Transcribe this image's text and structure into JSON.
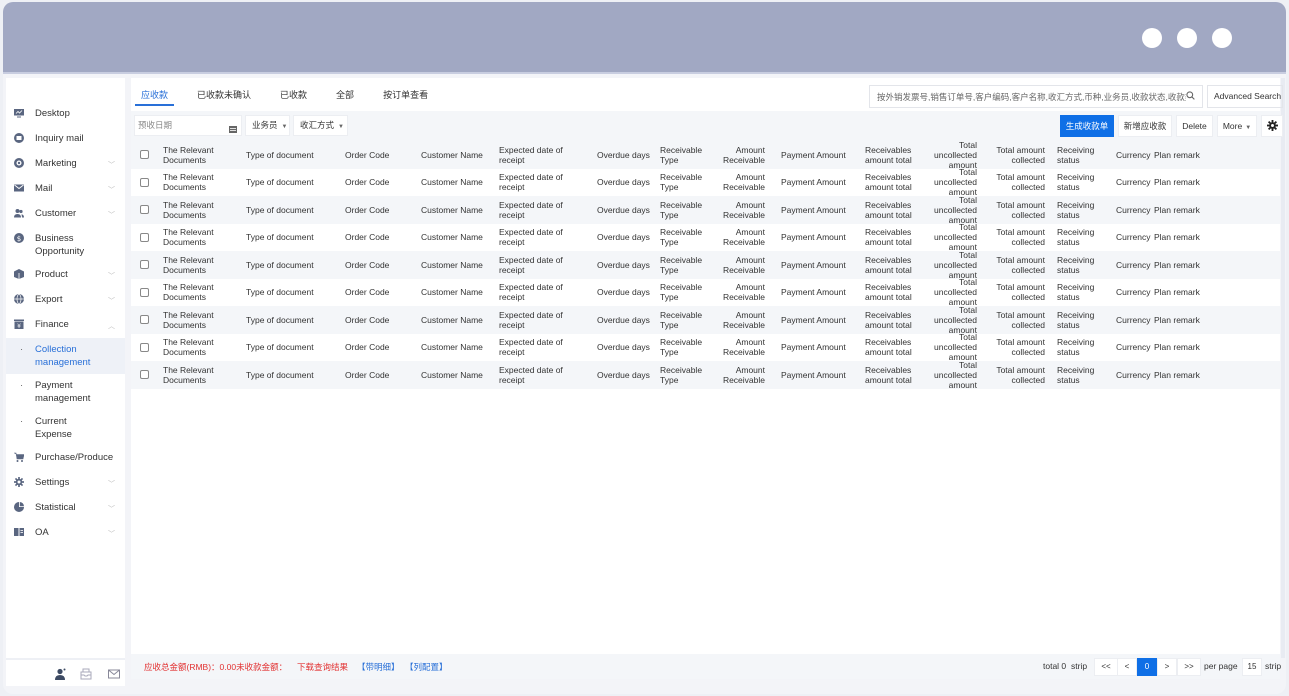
{
  "window": {
    "controls": [
      "dot",
      "dot",
      "dot"
    ]
  },
  "sidebar": {
    "items": [
      {
        "label": "Desktop",
        "icon": "desktop-icon",
        "chevron": false
      },
      {
        "label": "Inquiry mail",
        "icon": "inquiry-icon",
        "chevron": false
      },
      {
        "label": "Marketing",
        "icon": "marketing-icon",
        "chevron": true
      },
      {
        "label": "Mail",
        "icon": "mail-icon",
        "chevron": true
      },
      {
        "label": "Customer",
        "icon": "customer-icon",
        "chevron": true
      },
      {
        "label": "Business Opportunity",
        "icon": "dollar-icon",
        "chevron": false
      },
      {
        "label": "Product",
        "icon": "product-icon",
        "chevron": true
      },
      {
        "label": "Export",
        "icon": "globe-icon",
        "chevron": true
      },
      {
        "label": "Finance",
        "icon": "finance-icon",
        "chevron": "up"
      }
    ],
    "finance_sub": [
      {
        "label": "Collection management",
        "active": true
      },
      {
        "label": "Payment management",
        "active": false
      },
      {
        "label": "Current Expense",
        "active": false
      }
    ],
    "items_after": [
      {
        "label": "Purchase/Produce",
        "icon": "cart-icon",
        "chevron": false
      },
      {
        "label": "Settings",
        "icon": "gear-icon",
        "chevron": true
      },
      {
        "label": "Statistical",
        "icon": "pie-chart-icon",
        "chevron": true
      },
      {
        "label": "OA",
        "icon": "oa-icon",
        "chevron": true
      }
    ],
    "bottom_icons": [
      "user-icon",
      "inbox-icon",
      "envelope-icon"
    ]
  },
  "tabs": [
    {
      "label": "应收款",
      "active": true
    },
    {
      "label": "已收款未确认",
      "active": false
    },
    {
      "label": "已收款",
      "active": false
    },
    {
      "label": "全部",
      "active": false
    },
    {
      "label": "按订单查看",
      "active": false
    }
  ],
  "search": {
    "placeholder": "按外销发票号,销售订单号,客户编码,客户名称,收汇方式,币种,业务员,收款状态,收款类型",
    "advanced_label": "Advanced Search"
  },
  "filters": {
    "date_placeholder": "预收日期",
    "salesman_label": "业务员",
    "method_label": "收汇方式"
  },
  "actions": {
    "generate_label": "生成收款单",
    "add_label": "新增应收款",
    "delete_label": "Delete",
    "more_label": "More"
  },
  "table": {
    "columns": [
      "The Relevant Documents",
      "Type of document",
      "Order Code",
      "Customer Name",
      "Expected date of receipt",
      "Overdue days",
      "Receivable Type",
      "Amount Receivable",
      "Payment Amount",
      "Receivables amount total",
      "Total uncollected amount",
      "Total amount collected",
      "Receiving status",
      "Currency",
      "Plan remark"
    ],
    "rows": [
      [
        "The Relevant Documents",
        "Type of document",
        "Order Code",
        "Customer Name",
        "Expected date of receipt",
        "Overdue days",
        "Receivable Type",
        "Amount Receivable",
        "Payment Amount",
        "Receivables amount total",
        "Total uncollected amount",
        "Total amount collected",
        "Receiving status",
        "Currency",
        "Plan remark"
      ],
      [
        "The Relevant Documents",
        "Type of document",
        "Order Code",
        "Customer Name",
        "Expected date of receipt",
        "Overdue days",
        "Receivable Type",
        "Amount Receivable",
        "Payment Amount",
        "Receivables amount total",
        "Total uncollected amount",
        "Total amount collected",
        "Receiving status",
        "Currency",
        "Plan remark"
      ],
      [
        "The Relevant Documents",
        "Type of document",
        "Order Code",
        "Customer Name",
        "Expected date of receipt",
        "Overdue days",
        "Receivable Type",
        "Amount Receivable",
        "Payment Amount",
        "Receivables amount total",
        "Total uncollected amount",
        "Total amount collected",
        "Receiving status",
        "Currency",
        "Plan remark"
      ],
      [
        "The Relevant Documents",
        "Type of document",
        "Order Code",
        "Customer Name",
        "Expected date of receipt",
        "Overdue days",
        "Receivable Type",
        "Amount Receivable",
        "Payment Amount",
        "Receivables amount total",
        "Total uncollected amount",
        "Total amount collected",
        "Receiving status",
        "Currency",
        "Plan remark"
      ],
      [
        "The Relevant Documents",
        "Type of document",
        "Order Code",
        "Customer Name",
        "Expected date of receipt",
        "Overdue days",
        "Receivable Type",
        "Amount Receivable",
        "Payment Amount",
        "Receivables amount total",
        "Total uncollected amount",
        "Total amount collected",
        "Receiving status",
        "Currency",
        "Plan remark"
      ],
      [
        "The Relevant Documents",
        "Type of document",
        "Order Code",
        "Customer Name",
        "Expected date of receipt",
        "Overdue days",
        "Receivable Type",
        "Amount Receivable",
        "Payment Amount",
        "Receivables amount total",
        "Total uncollected amount",
        "Total amount collected",
        "Receiving status",
        "Currency",
        "Plan remark"
      ],
      [
        "The Relevant Documents",
        "Type of document",
        "Order Code",
        "Customer Name",
        "Expected date of receipt",
        "Overdue days",
        "Receivable Type",
        "Amount Receivable",
        "Payment Amount",
        "Receivables amount total",
        "Total uncollected amount",
        "Total amount collected",
        "Receiving status",
        "Currency",
        "Plan remark"
      ],
      [
        "The Relevant Documents",
        "Type of document",
        "Order Code",
        "Customer Name",
        "Expected date of receipt",
        "Overdue days",
        "Receivable Type",
        "Amount Receivable",
        "Payment Amount",
        "Receivables amount total",
        "Total uncollected amount",
        "Total amount collected",
        "Receiving status",
        "Currency",
        "Plan remark"
      ]
    ]
  },
  "footer": {
    "summary": "应收总金额(RMB)：0.00未收款金额：",
    "download": "下载查询结果",
    "detail_link": "【带明细】",
    "config_link": "【列配置】",
    "total_label": "total 0",
    "strip_label": "strip",
    "first": "<<",
    "prev": "<",
    "current_page": "0",
    "next": ">",
    "last": ">>",
    "per_page_label": "per page",
    "per_page_value": "15",
    "strip_label_2": "strip"
  },
  "colors": {
    "titlebar": "#a1a8c3",
    "accent": "#0f6fe6",
    "link": "#2970d8",
    "warning": "#e23232"
  }
}
